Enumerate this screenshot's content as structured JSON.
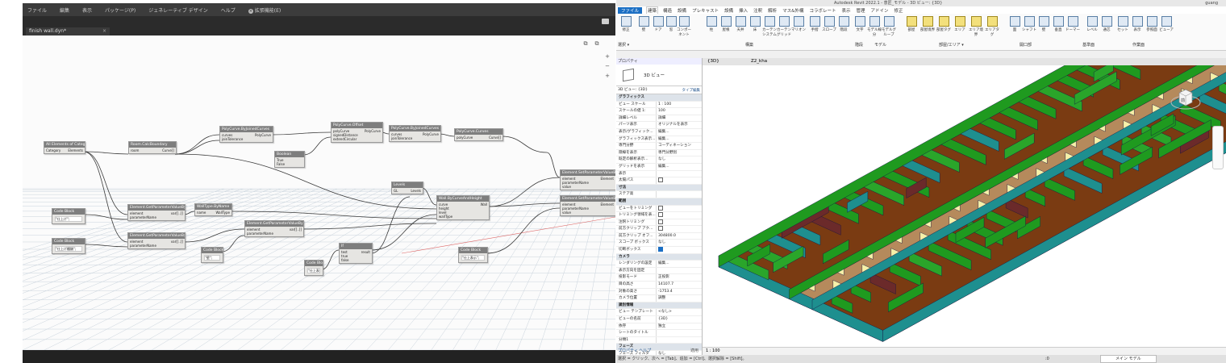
{
  "dynamo": {
    "menu": [
      "ファイル",
      "編集",
      "表示",
      "パッケージ(P)",
      "ジェネレーティブ デザイン",
      "ヘルプ",
      "拡張機能(E)"
    ],
    "tab_title": "finish wall.dyn*",
    "view_buttons": [
      "+",
      "−",
      "+"
    ],
    "nodes": [
      {
        "title": "All Elements of Category",
        "ports_in": [
          "Category"
        ],
        "ports_out": [
          "Elements"
        ]
      },
      {
        "title": "Room.CalcBoundary",
        "ports_in": [
          "room"
        ],
        "ports_out": [
          "Curve[]"
        ]
      },
      {
        "title": "PolyCurve.ByJoinedCurves",
        "ports_in": [
          "curves",
          "joinTolerance"
        ],
        "ports_out": [
          "PolyCurve"
        ]
      },
      {
        "title": "PolyCurve.Offset",
        "ports_in": [
          "polyCurve",
          "signedDistance",
          "extendCircular"
        ],
        "ports_out": [
          "PolyCurve"
        ]
      },
      {
        "title": "PolyCurve.ByJoinedCurves",
        "ports_in": [
          "curves",
          "joinTolerance"
        ],
        "ports_out": [
          "PolyCurve"
        ]
      },
      {
        "title": "PolyCurve.Curves",
        "ports_in": [
          "polyCurve"
        ],
        "ports_out": [
          "Curve[]"
        ]
      },
      {
        "title": "Boolean",
        "ports_in": [
          "True",
          "False"
        ],
        "ports_out": []
      },
      {
        "title": "Levels",
        "ports_in": [
          "GL"
        ],
        "ports_out": [
          "Levels"
        ]
      },
      {
        "title": "Wall.ByCurveAndHeight",
        "ports_in": [
          "curve",
          "height",
          "level",
          "wallType"
        ],
        "ports_out": [
          "Wall"
        ]
      },
      {
        "title": "Element.SetParameterValueByName",
        "ports_in": [
          "element",
          "parameterName",
          "value"
        ],
        "ports_out": [
          "Element"
        ]
      },
      {
        "title": "Element.SetParameterValueByName",
        "ports_in": [
          "element",
          "parameterName",
          "value"
        ],
        "ports_out": [
          "Element"
        ]
      },
      {
        "title": "Element.GetParameterValueByName",
        "ports_in": [
          "element",
          "parameterName"
        ],
        "ports_out": [
          "var[]..[]"
        ]
      },
      {
        "title": "WallType.ByName",
        "ports_in": [
          "name"
        ],
        "ports_out": [
          "WallType"
        ]
      },
      {
        "title": "Element.GetParameterValueByName",
        "ports_in": [
          "element",
          "parameterName"
        ],
        "ports_out": [
          "var[]..[]"
        ]
      },
      {
        "title": "Element.GetParameterValueByName",
        "ports_in": [
          "element",
          "parameterName"
        ],
        "ports_out": [
          "var[]..[]"
        ]
      },
      {
        "title": "Code Block",
        "ports_in": [
          "\"仕上げ\";"
        ],
        "ports_out": []
      },
      {
        "title": "Code Block",
        "ports_in": [
          "\"仕上げ種類\";"
        ],
        "ports_out": []
      },
      {
        "title": "Code Block",
        "ports_in": [
          "\"壁\";"
        ],
        "ports_out": []
      },
      {
        "title": "Code Block",
        "ports_in": [
          "\"仕上表\";"
        ],
        "ports_out": []
      },
      {
        "title": "Code Block",
        "ports_in": [
          "\"仕上表示\";"
        ],
        "ports_out": []
      },
      {
        "title": "If",
        "ports_in": [
          "test",
          "true",
          "false"
        ],
        "ports_out": [
          "result"
        ]
      }
    ]
  },
  "revit": {
    "title": "Autodesk Revit 2022.1 - 意匠_モデル - 3D ビュー: {3D}",
    "user": "guang",
    "tabs": [
      "ファイル",
      "建築",
      "構造",
      "設備",
      "プレキャスト",
      "設備",
      "挿入",
      "注釈",
      "解析",
      "マス&外構",
      "コラボレート",
      "表示",
      "管理",
      "アドイン",
      "修正"
    ],
    "ribbon_buttons": [
      "修正",
      "壁",
      "ドア",
      "窓",
      "コンポーネント",
      "柱",
      "屋根",
      "天井",
      "床",
      "カーテンシステム",
      "カーテングリッド",
      "マリオン",
      "手摺",
      "スロープ",
      "階段",
      "文字",
      "モデル線分",
      "モデルグループ",
      "部屋",
      "部屋境界",
      "部屋タグ",
      "エリア",
      "エリア境界",
      "エリアタグ",
      "面",
      "シャフト",
      "壁",
      "垂直",
      "ドーマー",
      "レベル",
      "通芯",
      "セット",
      "表示",
      "参照面",
      "ビューア"
    ],
    "ribbon_groups": [
      "選択 ▾",
      "構築",
      "階段",
      "モデル",
      "部屋/エリア ▾",
      "開口部",
      "基準面",
      "作業面"
    ],
    "properties": {
      "header": "プロパティ",
      "view_name": "3D ビュー",
      "selector": "3D ビュー: {3D}",
      "edit_type": "タイプ編集",
      "rows": [
        {
          "k": "グラフィックス",
          "v": "",
          "group": true
        },
        {
          "k": "ビュー スケール",
          "v": "1 : 100"
        },
        {
          "k": "スケールの値 1:",
          "v": "100"
        },
        {
          "k": "詳細レベル",
          "v": "詳細"
        },
        {
          "k": "パーツ表示",
          "v": "オリジナルを表示"
        },
        {
          "k": "表示/グラフィック...",
          "v": "編集..."
        },
        {
          "k": "グラフィックス表示...",
          "v": "編集..."
        },
        {
          "k": "専門分野",
          "v": "コーディネーション"
        },
        {
          "k": "隠線を表示",
          "v": "専門分野別"
        },
        {
          "k": "既定の解析表示...",
          "v": "なし"
        },
        {
          "k": "グリッドを表示",
          "v": "編集..."
        },
        {
          "k": "表示",
          "v": ""
        },
        {
          "k": "太陽パス",
          "v": "cb0"
        },
        {
          "k": "寸法",
          "v": "",
          "group": true
        },
        {
          "k": "ステア高",
          "v": ""
        },
        {
          "k": "範囲",
          "v": "",
          "group": true
        },
        {
          "k": "ビューをトリミング",
          "v": "cb0"
        },
        {
          "k": "トリミング領域を表...",
          "v": "cb0"
        },
        {
          "k": "注釈トリミング",
          "v": "cb0"
        },
        {
          "k": "前方クリップ アク...",
          "v": "cb0"
        },
        {
          "k": "前方クリップ オフ...",
          "v": "304800.0"
        },
        {
          "k": "スコープ ボックス",
          "v": "なし"
        },
        {
          "k": "切断ボックス",
          "v": "cb1"
        },
        {
          "k": "カメラ",
          "v": "",
          "group": true
        },
        {
          "k": "レンダリングの設定",
          "v": "編集..."
        },
        {
          "k": "表示方向を固定",
          "v": ""
        },
        {
          "k": "投影モード",
          "v": "正投影"
        },
        {
          "k": "目の高さ",
          "v": "14107.7"
        },
        {
          "k": "対象の高さ",
          "v": "-1753.4"
        },
        {
          "k": "カメラ位置",
          "v": "調整"
        },
        {
          "k": "識別情報",
          "v": "",
          "group": true
        },
        {
          "k": "ビュー テンプレート",
          "v": "<なし>"
        },
        {
          "k": "ビューの名前",
          "v": "{3D}"
        },
        {
          "k": "依存",
          "v": "独立"
        },
        {
          "k": "シートのタイトル",
          "v": ""
        },
        {
          "k": "分類1",
          "v": ""
        },
        {
          "k": "フェーズ",
          "v": "",
          "group": true
        },
        {
          "k": "フェーズ フィルタ",
          "v": "なし"
        }
      ],
      "help": "プロパティ ヘルプ",
      "apply": "適用"
    },
    "view_tabs": [
      "{3D}",
      "Z2_kha"
    ],
    "view_scale": "1 : 100",
    "status_text": "選択 = クリック、次へ = [Tab]、追加 = [Ctrl]、選択解除 = [Shift]。",
    "status_right": "メイン モデル",
    "status_num": ":0",
    "navcube_label": "前"
  }
}
